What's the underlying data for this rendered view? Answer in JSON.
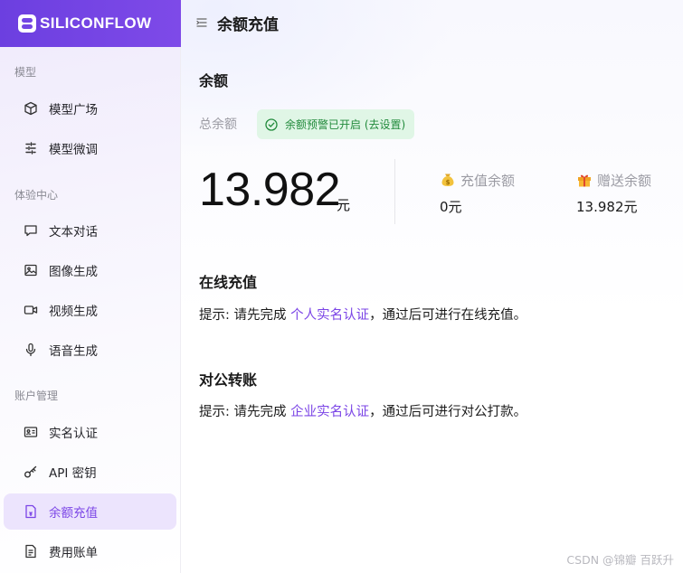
{
  "brand": {
    "name": "SILICONFLOW"
  },
  "header": {
    "title": "余额充值"
  },
  "sidebar": {
    "sections": [
      {
        "title": "模型",
        "items": [
          {
            "label": "模型广场",
            "icon": "cube-icon"
          },
          {
            "label": "模型微调",
            "icon": "sliders-icon"
          }
        ]
      },
      {
        "title": "体验中心",
        "items": [
          {
            "label": "文本对话",
            "icon": "chat-bubble-icon"
          },
          {
            "label": "图像生成",
            "icon": "image-icon"
          },
          {
            "label": "视频生成",
            "icon": "video-camera-icon"
          },
          {
            "label": "语音生成",
            "icon": "microphone-icon"
          }
        ]
      },
      {
        "title": "账户管理",
        "items": [
          {
            "label": "实名认证",
            "icon": "id-card-icon"
          },
          {
            "label": "API 密钥",
            "icon": "key-icon"
          },
          {
            "label": "余额充值",
            "icon": "recharge-icon",
            "active": true
          },
          {
            "label": "费用账单",
            "icon": "bill-icon"
          }
        ]
      }
    ]
  },
  "balance": {
    "heading": "余额",
    "total_label": "总余额",
    "alert_badge": "余额预警已开启 (去设置)",
    "amount": "13.982",
    "unit": "元",
    "recharge": {
      "label": "充值余额",
      "value": "0元",
      "icon": "money-bag-icon"
    },
    "gift": {
      "label": "赠送余额",
      "value": "13.982元",
      "icon": "gift-icon"
    }
  },
  "online": {
    "heading": "在线充值",
    "hint_prefix": "提示: 请先完成 ",
    "hint_link": "个人实名认证",
    "hint_suffix": "，通过后可进行在线充值。"
  },
  "transfer": {
    "heading": "对公转账",
    "hint_prefix": "提示: 请先完成 ",
    "hint_link": "企业实名认证",
    "hint_suffix": "，通过后可进行对公打款。"
  },
  "watermark": "CSDN @锦瓣 百跃升",
  "colors": {
    "accent": "#7b45e6",
    "brand_gradient_start": "#6c3fe0",
    "success": "#228b3c",
    "success_bg": "#e0f6e6"
  }
}
